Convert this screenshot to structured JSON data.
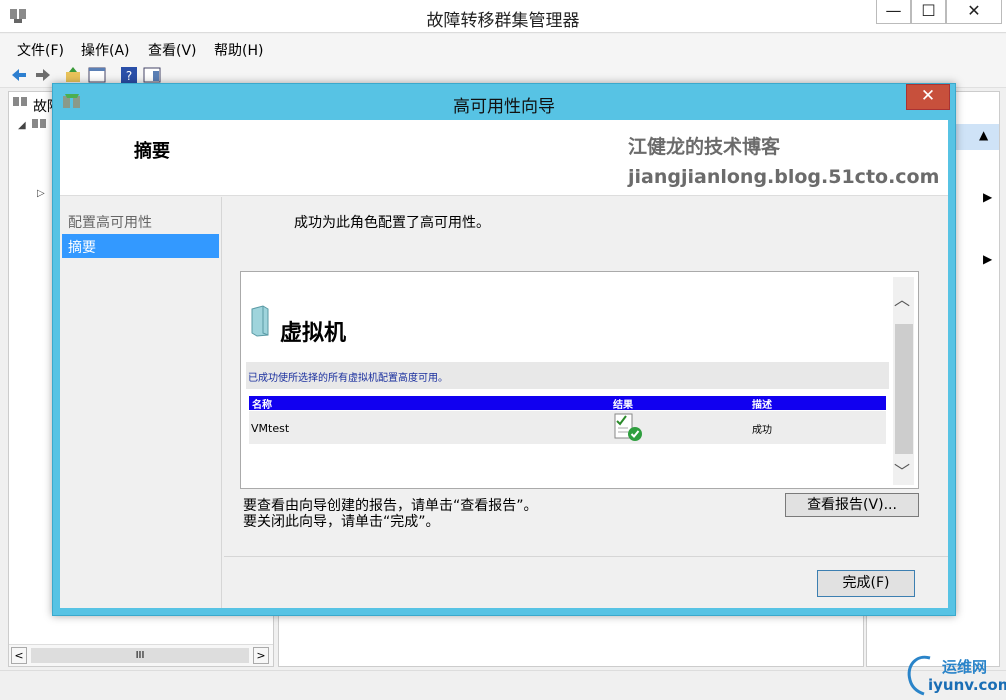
{
  "window": {
    "title": "故障转移群集管理器",
    "min": "—",
    "max": "☐",
    "close": "✕"
  },
  "menu": [
    "文件(F)",
    "操作(A)",
    "查看(V)",
    "帮助(H)"
  ],
  "tree": {
    "root_label": "故障"
  },
  "scrollbar": {
    "grip": "III",
    "left": "<",
    "right": ">"
  },
  "dialog": {
    "title": "高可用性向导",
    "close": "✕",
    "header_title": "摘要",
    "watermark_line1": "江健龙的技术博客",
    "watermark_line2": "jiangjianlong.blog.51cto.com",
    "steps": [
      "配置高可用性",
      "摘要"
    ],
    "selected_step": "摘要",
    "message": "成功为此角色配置了高可用性。",
    "report": {
      "heading": "虚拟机",
      "info": "已成功使所选择的所有虚拟机配置高度可用。",
      "columns": [
        "名称",
        "结果",
        "描述"
      ],
      "rows": [
        {
          "name": "VMtest",
          "description": "成功"
        }
      ]
    },
    "hint_line1": "要查看由向导创建的报告，请单击“查看报告”。",
    "hint_line2": "要关闭此向导，请单击“完成”。",
    "view_report_button": "查看报告(V)...",
    "finish_button": "完成(F)"
  },
  "logo": {
    "line1": "运维网",
    "line2": "iyunv.com"
  },
  "colors": {
    "dialog_frame": "#57c3e4",
    "selected_step": "#3399ff",
    "table_header": "#1100f0",
    "close_button": "#c7503c"
  }
}
